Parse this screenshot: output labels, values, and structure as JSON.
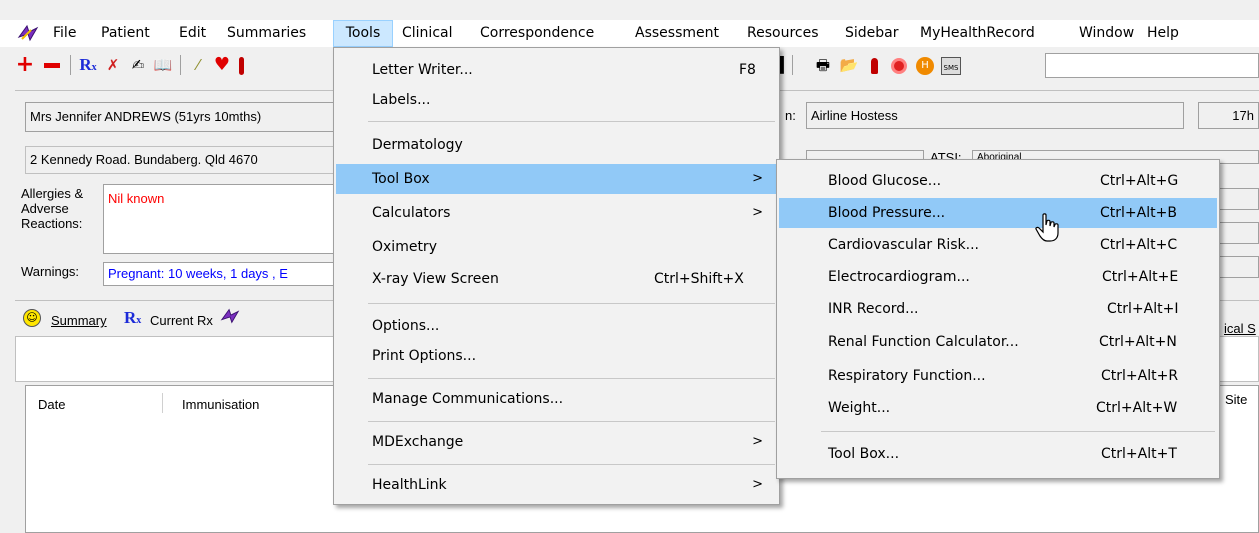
{
  "menubar": {
    "items": [
      "File",
      "Patient",
      "Edit",
      "Summaries",
      "Tools",
      "Clinical",
      "Correspondence",
      "Assessment",
      "Resources",
      "Sidebar",
      "MyHealthRecord",
      "Window",
      "Help"
    ]
  },
  "patient": {
    "name": "Mrs Jennifer ANDREWS (51yrs 10mths)",
    "address": "2 Kennedy Road. Bundaberg. Qld  4670",
    "allergies_label": "Allergies & Adverse Reactions:",
    "allergies_value": "Nil known",
    "warnings_label": "Warnings:",
    "warnings_value": "Pregnant:  10 weeks, 1 days , E",
    "occupation_label": "n:",
    "occupation_value": "Airline Hostess",
    "time_value": "17h",
    "atsi_label": "ATSI:",
    "atsi_value": "Aboriginal"
  },
  "tabs": {
    "summary": "Summary",
    "current_rx": "Current Rx",
    "clinical_s": "ical S"
  },
  "grid": {
    "columns": [
      "Date",
      "Immunisation",
      "Site"
    ]
  },
  "tools_menu": {
    "items": [
      {
        "label": "Letter Writer...",
        "shortcut": "F8"
      },
      {
        "label": "Labels...",
        "shortcut": ""
      },
      {
        "label": "Dermatology",
        "shortcut": ""
      },
      {
        "label": "Tool Box",
        "shortcut": "",
        "submenu": true
      },
      {
        "label": "Calculators",
        "shortcut": "",
        "submenu": true
      },
      {
        "label": "Oximetry",
        "shortcut": ""
      },
      {
        "label": "X-ray View Screen",
        "shortcut": "Ctrl+Shift+X"
      },
      {
        "label": "Options...",
        "shortcut": ""
      },
      {
        "label": "Print Options...",
        "shortcut": ""
      },
      {
        "label": "Manage Communications...",
        "shortcut": ""
      },
      {
        "label": "MDExchange",
        "shortcut": "",
        "submenu": true
      },
      {
        "label": "HealthLink",
        "shortcut": "",
        "submenu": true
      }
    ]
  },
  "toolbox_menu": {
    "items": [
      {
        "label": "Blood Glucose...",
        "shortcut": "Ctrl+Alt+G"
      },
      {
        "label": "Blood Pressure...",
        "shortcut": "Ctrl+Alt+B"
      },
      {
        "label": "Cardiovascular Risk...",
        "shortcut": "Ctrl+Alt+C"
      },
      {
        "label": "Electrocardiogram...",
        "shortcut": "Ctrl+Alt+E"
      },
      {
        "label": "INR Record...",
        "shortcut": "Ctrl+Alt+I"
      },
      {
        "label": "Renal Function Calculator...",
        "shortcut": "Ctrl+Alt+N"
      },
      {
        "label": "Respiratory Function...",
        "shortcut": "Ctrl+Alt+R"
      },
      {
        "label": "Weight...",
        "shortcut": "Ctrl+Alt+W"
      },
      {
        "label": "Tool Box...",
        "shortcut": "Ctrl+Alt+T"
      }
    ]
  },
  "colors": {
    "highlight": "#91c9f7",
    "menu_bg": "#f2f2f2",
    "allergy_text": "#ff0000",
    "warning_text": "#0000ff"
  },
  "icons": [
    "app-logo-icon",
    "add-icon",
    "remove-icon",
    "prescription-icon",
    "run-icon",
    "signature-icon",
    "book-icon",
    "pen-icon",
    "heart-icon",
    "thermometer-icon",
    "printer-icon",
    "folder-open-icon",
    "person-icon",
    "circle-logo-icon",
    "orange-badge-icon",
    "sms-icon",
    "smiley-icon",
    "rx-tab-icon",
    "hand-cursor-icon"
  ]
}
